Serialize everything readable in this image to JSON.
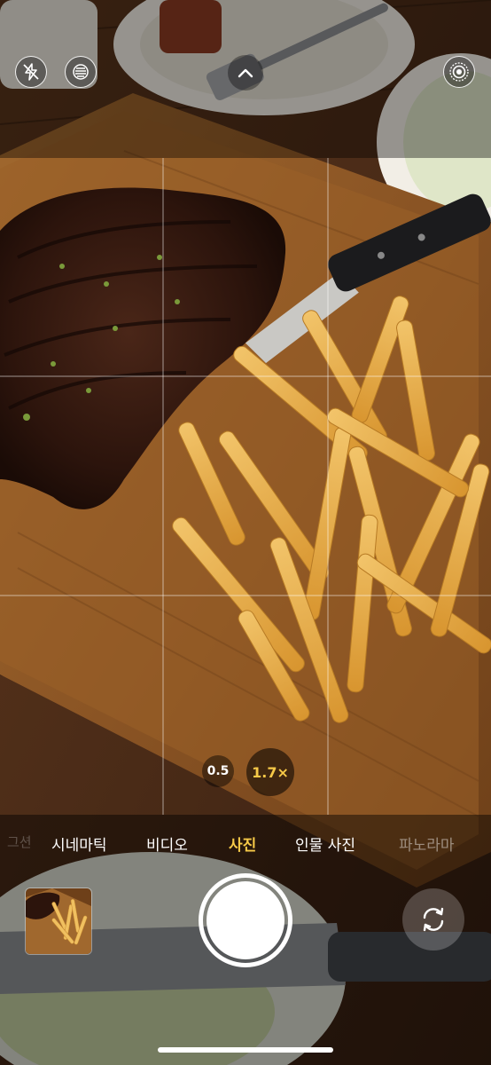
{
  "camera": {
    "zoom": {
      "option_wide": "0.5",
      "option_selected": "1.7×"
    },
    "modes": {
      "edge_left": "그션",
      "cinematic": "시네마틱",
      "video": "비디오",
      "photo": "사진",
      "portrait": "인물 사진",
      "panorama": "파노라마"
    },
    "active_mode": "photo",
    "icons": {
      "flash": "flash-off-icon",
      "night": "night-mode-icon",
      "chevron": "chevron-up-icon",
      "live": "live-photo-icon",
      "flip": "camera-flip-icon"
    },
    "colors": {
      "accent": "#f7c948"
    }
  }
}
